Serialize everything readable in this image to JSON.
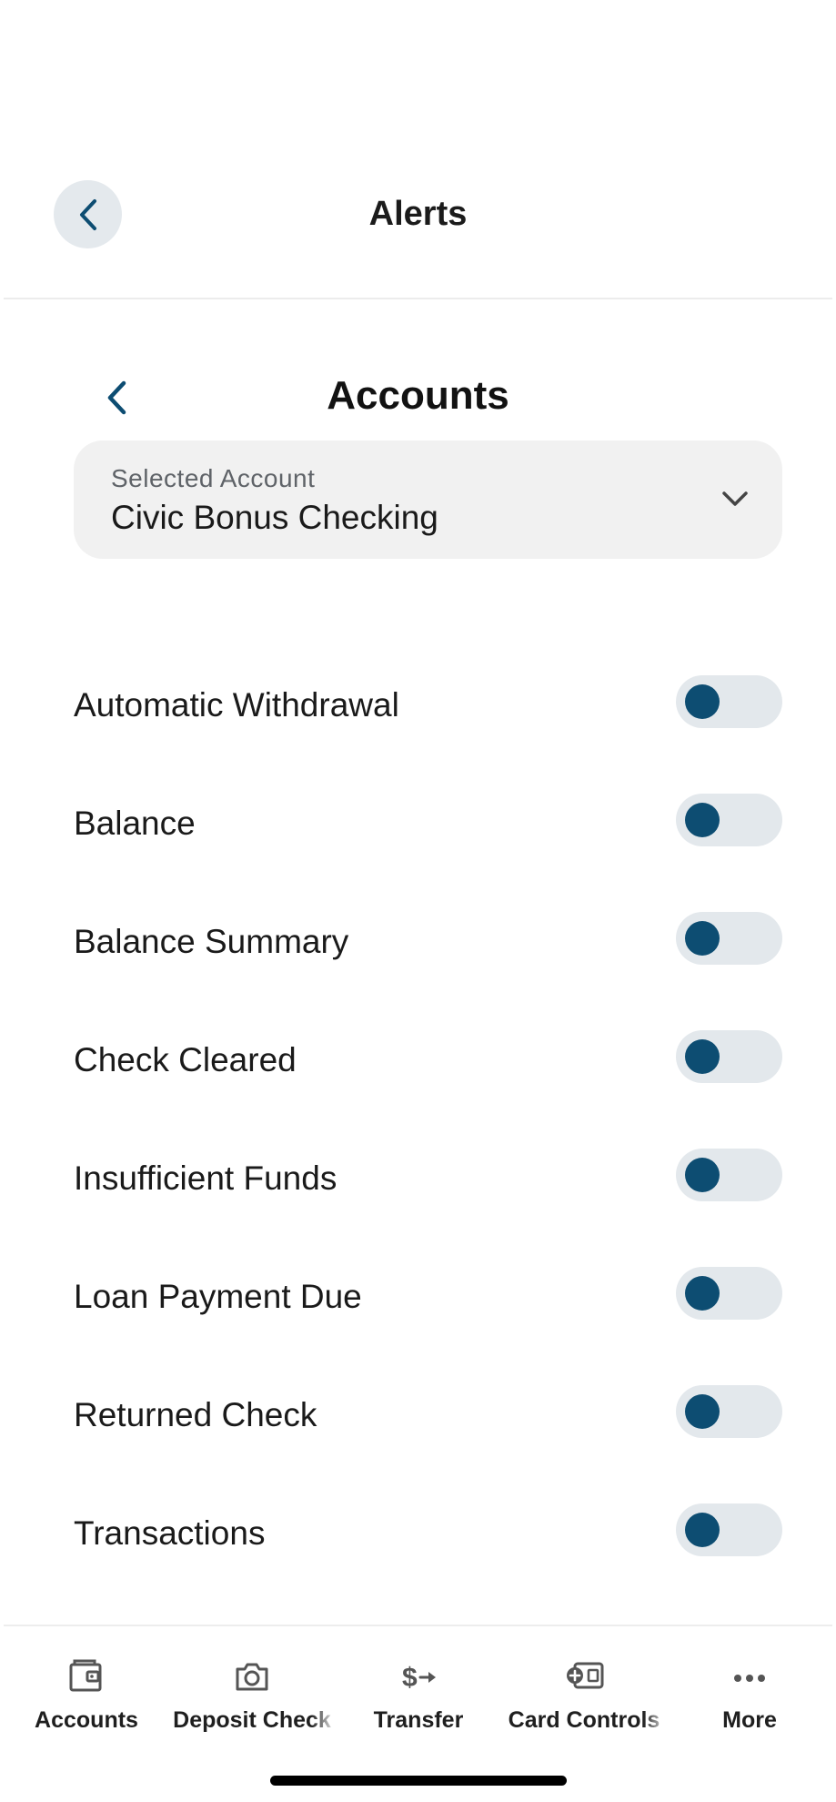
{
  "header": {
    "title": "Alerts"
  },
  "subheader": {
    "title": "Accounts"
  },
  "account_selector": {
    "label": "Selected Account",
    "value": "Civic Bonus Checking"
  },
  "alerts": [
    {
      "label": "Automatic Withdrawal",
      "enabled": false
    },
    {
      "label": "Balance",
      "enabled": false
    },
    {
      "label": "Balance Summary",
      "enabled": false
    },
    {
      "label": "Check Cleared",
      "enabled": false
    },
    {
      "label": "Insufficient Funds",
      "enabled": false
    },
    {
      "label": "Loan Payment Due",
      "enabled": false
    },
    {
      "label": "Returned Check",
      "enabled": false
    },
    {
      "label": "Transactions",
      "enabled": false
    }
  ],
  "tabs": [
    {
      "label": "Accounts",
      "icon": "wallet-icon"
    },
    {
      "label": "Deposit Check",
      "icon": "camera-icon"
    },
    {
      "label": "Transfer",
      "icon": "dollar-transfer-icon"
    },
    {
      "label": "Card Controls",
      "icon": "card-control-icon"
    },
    {
      "label": "More",
      "icon": "more-dots-icon"
    }
  ],
  "colors": {
    "accent": "#0d4d72",
    "toggle_track": "#e3e8ec",
    "back_button_bg": "#e4e9ed",
    "selector_bg": "#f1f1f1"
  }
}
